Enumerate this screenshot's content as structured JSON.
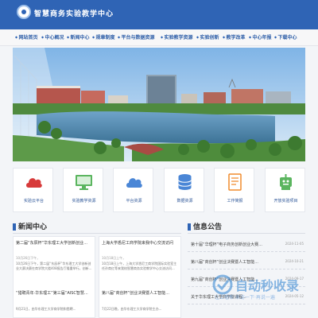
{
  "header": {
    "title": "智慧商务实验教学中心"
  },
  "nav": {
    "items": [
      "网站首页",
      "中心概况",
      "新闻中心",
      "规章制度",
      "平台与数据资源",
      "实验教学资源",
      "实验创新",
      "教学改革",
      "中心年报",
      "下载中心"
    ]
  },
  "cards": [
    {
      "label": "实验云平台",
      "icon": "cloud-icon",
      "color": "#d73a3a"
    },
    {
      "label": "实验教学资源",
      "icon": "monitor-icon",
      "color": "#5bb55f"
    },
    {
      "label": "平台资源",
      "icon": "cloud-icon",
      "color": "#4a86d6"
    },
    {
      "label": "数据资源",
      "icon": "database-icon",
      "color": "#4a86d6"
    },
    {
      "label": "工作简报",
      "icon": "document-icon",
      "color": "#f08b2d"
    },
    {
      "label": "开放实验项目",
      "icon": "robot-icon",
      "color": "#5bb55f"
    }
  ],
  "news": {
    "title": "新闻中心",
    "columns": [
      {
        "title1": "第二届“东辰杯”华东理工大学创新创业...",
        "date": "10月26日下午，",
        "snippet1": "10月26日下午，第二届“东辰杯”华东理工大学创新创业大赛决赛在商学院大楼408报告厅隆重举行。创新...",
        "title2": "“猎聘青年·华东理工”第三届“AISC智慧...",
        "snippet2": "9月21日，由华东理工大学商学院和猎聘..."
      },
      {
        "title1": "上海大学悉尼工商学院来我中心交流访问",
        "date": "10月18日上午，",
        "snippet1": "10月18日上午，上海大学悉尼工商学院国际实验室主任孙商红等来我校智慧商务实验教学中心交流访问...",
        "title2": "第八届“商创杯”创业决赛暨人工智能...",
        "snippet2": "7月22日晚，由华东理工大学商学院主办..."
      }
    ]
  },
  "notice": {
    "title": "信息公告",
    "items": [
      {
        "text": "第十届“华理杯”电子商务创新创业大赛...",
        "date": "2024-11-05"
      },
      {
        "text": "第八届“商创杯”创业决赛暨人工智能...",
        "date": "2024-10-21"
      },
      {
        "text": "第九届“商创杯”创业决赛暨人工智能...",
        "date": "2024-09-17"
      },
      {
        "text": "关于华东理工大学商学院课程...",
        "date": "2024-05-12"
      }
    ]
  },
  "watermark": {
    "text": "自动秒收录",
    "sub": "让上墙帮·来访一下·再说一遍"
  }
}
